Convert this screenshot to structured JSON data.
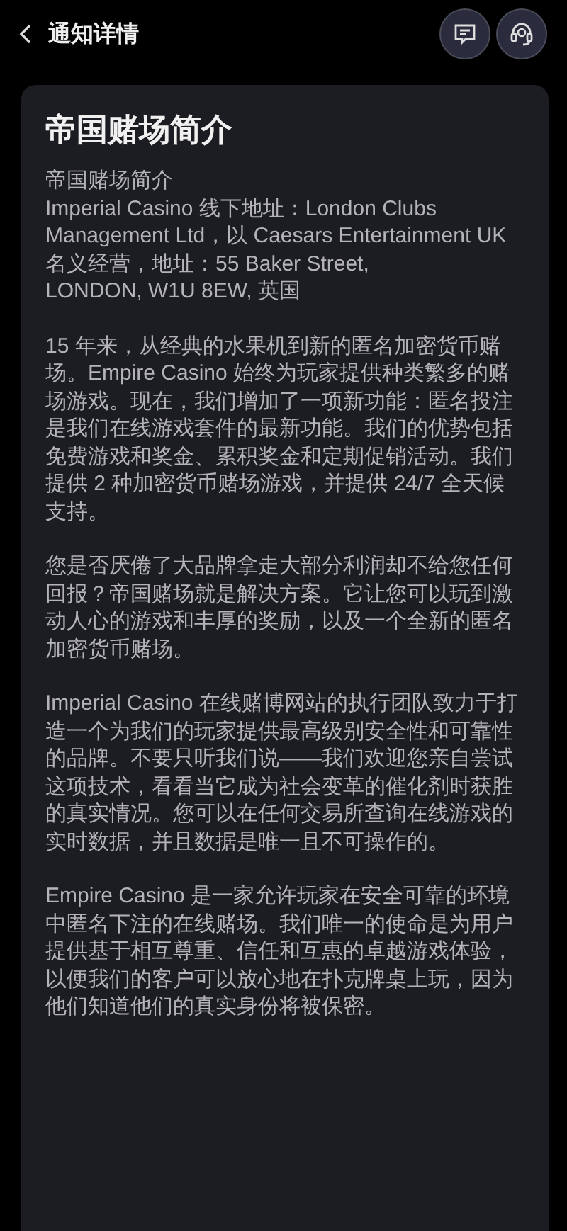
{
  "header": {
    "title": "通知详情"
  },
  "article": {
    "title": "帝国赌场简介",
    "paragraphs": [
      {
        "lines": [
          "帝国赌场简介",
          "Imperial Casino 线下地址：London Clubs Management Ltd，以 Caesars Entertainment UK 名义经营，地址：55 Baker Street,",
          "LONDON, W1U 8EW, 英国"
        ]
      },
      {
        "lines": [
          "15 年来，从经典的水果机到新的匿名加密货币赌场。Empire Casino 始终为玩家提供种类繁多的赌场游戏。现在，我们增加了一项新功能：匿名投注是我们在线游戏套件的最新功能。我们的优势包括免费游戏和奖金、累积奖金和定期促销活动。我们提供 2 种加密货币赌场游戏，并提供 24/7 全天候支持。"
        ]
      },
      {
        "lines": [
          "您是否厌倦了大品牌拿走大部分利润却不给您任何回报？帝国赌场就是解决方案。它让您可以玩到激动人心的游戏和丰厚的奖励，以及一个全新的匿名加密货币赌场。"
        ]
      },
      {
        "lines": [
          "Imperial Casino 在线赌博网站的执行团队致力于打造一个为我们的玩家提供最高级别安全性和可靠性的品牌。不要只听我们说——我们欢迎您亲自尝试这项技术，看看当它成为社会变革的催化剂时获胜的真实情况。您可以在任何交易所查询在线游戏的实时数据，并且数据是唯一且不可操作的。"
        ]
      },
      {
        "lines": [
          "Empire Casino 是一家允许玩家在安全可靠的环境中匿名下注的在线赌场。我们唯一的使命是为用户提供基于相互尊重、信任和互惠的卓越游戏体验，以便我们的客户可以放心地在扑克牌桌上玩，因为他们知道他们的真实身份将被保密。"
        ]
      }
    ]
  }
}
